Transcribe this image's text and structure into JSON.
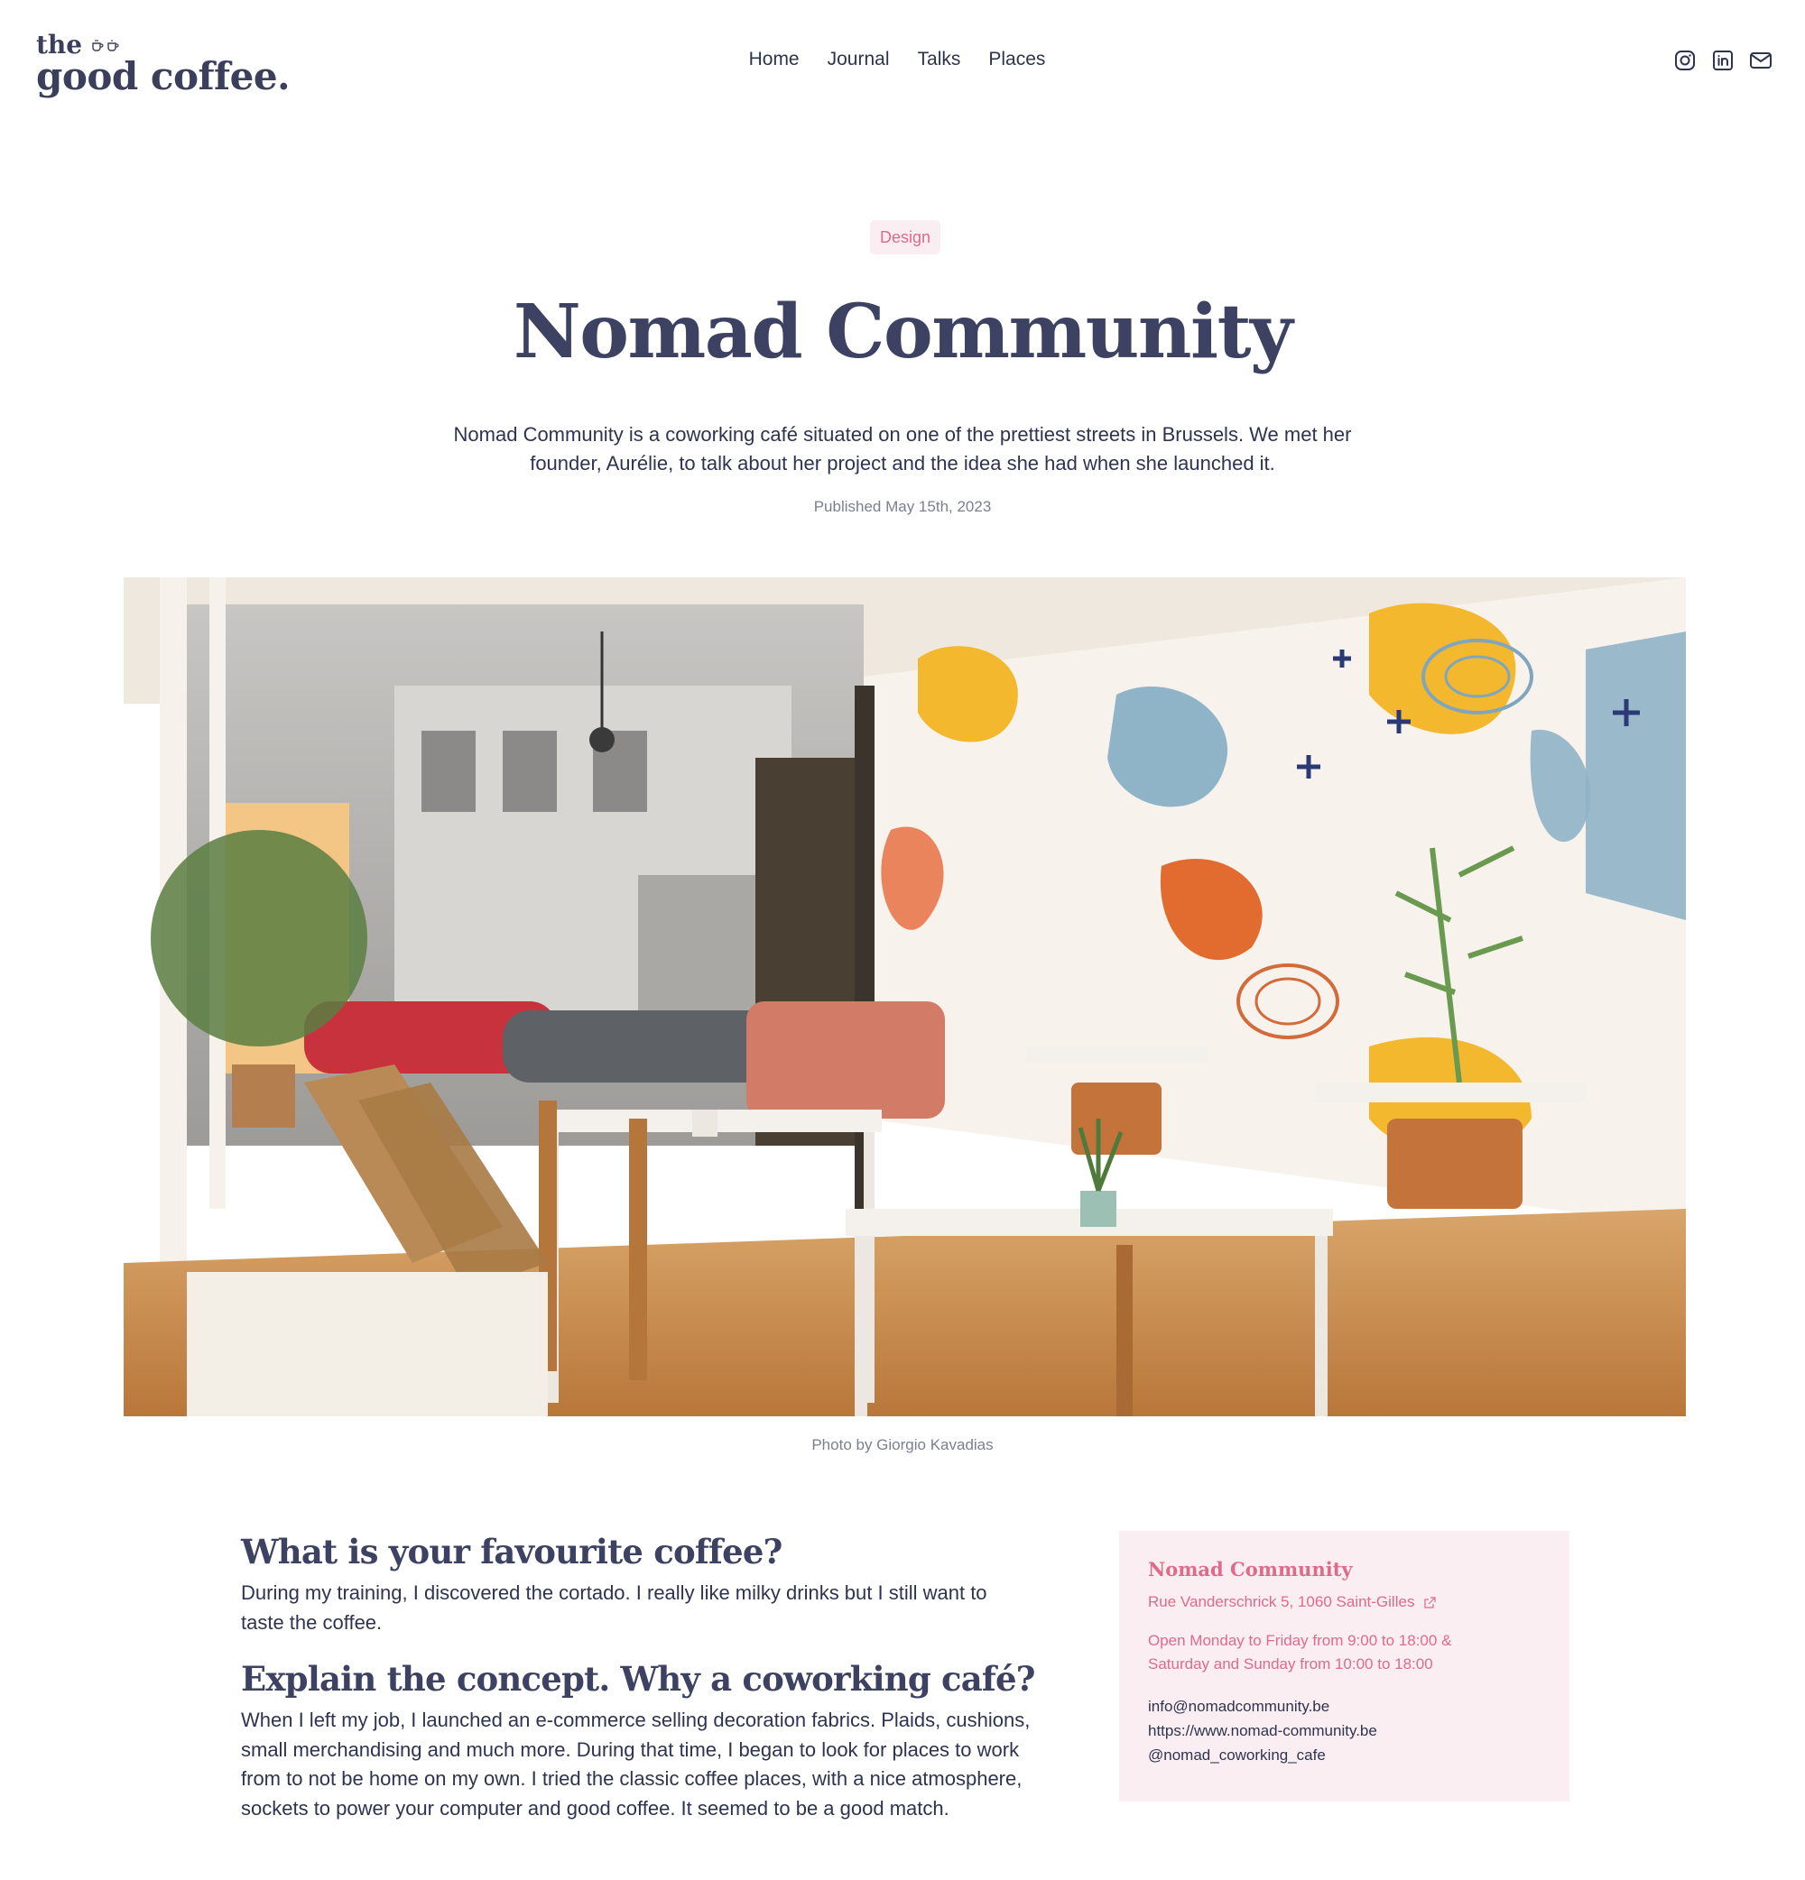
{
  "header": {
    "logo_line1": "the",
    "logo_line2": "good coffee.",
    "nav": [
      "Home",
      "Journal",
      "Talks",
      "Places"
    ],
    "social_icons": [
      "instagram-icon",
      "linkedin-icon",
      "mail-icon"
    ]
  },
  "article": {
    "tag": "Design",
    "title": "Nomad Community",
    "intro": "Nomad Community is a coworking café situated on one of the prettiest streets in Brussels. We met her founder, Aurélie, to talk about her project and the idea she had when she launched it.",
    "published": "Published May 15th, 2023",
    "photo_caption": "Photo by Giorgio Kavadias",
    "sections": [
      {
        "heading": "What is your favourite coffee?",
        "body": "During my training, I discovered the cortado. I really like milky drinks but I still want to taste the coffee."
      },
      {
        "heading": "Explain the concept. Why a coworking café?",
        "body": "When I left my job, I launched an e-commerce selling decoration fabrics. Plaids, cushions, small merchandising and much more. During that time, I began to look for places to work from to not be home on my own. I tried the classic coffee places, with a nice atmosphere, sockets to power your computer and good coffee. It seemed to be a good match."
      }
    ]
  },
  "place": {
    "name": "Nomad Community",
    "address": "Rue Vanderschrick 5, 1060 Saint-Gilles",
    "hours_line1": "Open Monday to Friday from 9:00 to 18:00 &",
    "hours_line2": "Saturday and Sunday from 10:00 to 18:00",
    "email": "info@nomadcommunity.be",
    "website": "https://www.nomad-community.be",
    "instagram": "@nomad_coworking_cafe"
  },
  "colors": {
    "accent": "#e06a8a",
    "navy": "#3d4262",
    "tag_bg": "#fbeef2"
  }
}
